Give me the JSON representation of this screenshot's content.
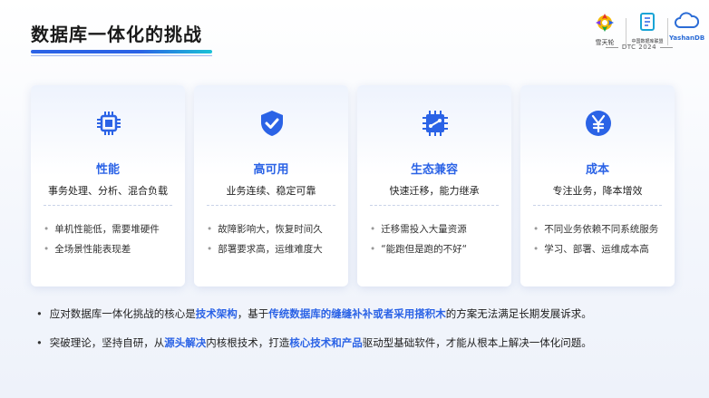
{
  "header": {
    "title": "数据库一体化的挑战"
  },
  "logos": {
    "logo1_text": "雪天轮",
    "logo2_text": "中国数据库联盟",
    "logo3_text": "YashanDB",
    "event": "DTC 2024"
  },
  "cards": [
    {
      "icon": "chip-icon",
      "title": "性能",
      "subtitle": "事务处理、分析、混合负载",
      "points": [
        "单机性能低，需要堆硬件",
        "全场景性能表现差"
      ]
    },
    {
      "icon": "shield-check-icon",
      "title": "高可用",
      "subtitle": "业务连续、稳定可靠",
      "points": [
        "故障影响大，恢复时间久",
        "部署要求高，运维难度大"
      ]
    },
    {
      "icon": "ecosystem-icon",
      "title": "生态兼容",
      "subtitle": "快速迁移，能力继承",
      "points": [
        "迁移需投入大量资源",
        "“能跑但是跑的不好“"
      ]
    },
    {
      "icon": "yen-icon",
      "title": "成本",
      "subtitle": "专注业务，降本增效",
      "points": [
        "不同业务依赖不同系统服务",
        "学习、部署、运维成本高"
      ]
    }
  ],
  "bullets": [
    {
      "parts": [
        {
          "text": "应对数据库一体化挑战的核心是",
          "hl": false
        },
        {
          "text": "技术架构",
          "hl": true
        },
        {
          "text": "，基于",
          "hl": false
        },
        {
          "text": "传统数据库的缝缝补补或者采用搭积木",
          "hl": true
        },
        {
          "text": "的方案无法满足长期发展诉求。",
          "hl": false
        }
      ]
    },
    {
      "parts": [
        {
          "text": "突破理论，坚持自研，从",
          "hl": false
        },
        {
          "text": "源头解决",
          "hl": true
        },
        {
          "text": "内核根技术，打造",
          "hl": false
        },
        {
          "text": "核心技术和产品",
          "hl": true
        },
        {
          "text": "驱动型基础软件，才能从根本上解决一体化问题。",
          "hl": false
        }
      ]
    }
  ],
  "colors": {
    "accent": "#2b63e6",
    "accent2": "#19c2d6"
  }
}
